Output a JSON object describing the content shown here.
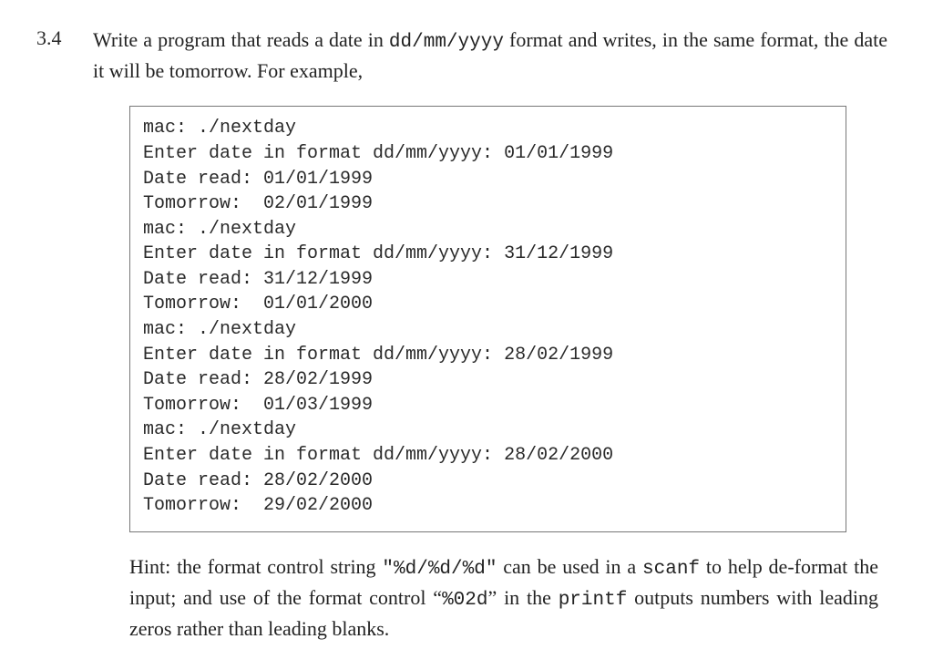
{
  "exercise": {
    "number": "3.4",
    "text_part1": "Write a program that reads a date in ",
    "text_mono1": "dd/mm/yyyy",
    "text_part2": " format and writes, in the same format, the date it will be tomorrow. For example,"
  },
  "code_lines": [
    "mac: ./nextday",
    "Enter date in format dd/mm/yyyy: 01/01/1999",
    "Date read: 01/01/1999",
    "Tomorrow:  02/01/1999",
    "mac: ./nextday",
    "Enter date in format dd/mm/yyyy: 31/12/1999",
    "Date read: 31/12/1999",
    "Tomorrow:  01/01/2000",
    "mac: ./nextday",
    "Enter date in format dd/mm/yyyy: 28/02/1999",
    "Date read: 28/02/1999",
    "Tomorrow:  01/03/1999",
    "mac: ./nextday",
    "Enter date in format dd/mm/yyyy: 28/02/2000",
    "Date read: 28/02/2000",
    "Tomorrow:  29/02/2000"
  ],
  "hint": {
    "part1": "Hint: the format control string ",
    "mono1": "\"%d/%d/%d\"",
    "part2": " can be used in a ",
    "mono2": "scanf",
    "part3": " to help de-format the input; and use of the format control “",
    "mono3": "%02d",
    "part4": "” in the ",
    "mono4": "printf",
    "part5": " outputs numbers with leading zeros rather than leading blanks."
  }
}
